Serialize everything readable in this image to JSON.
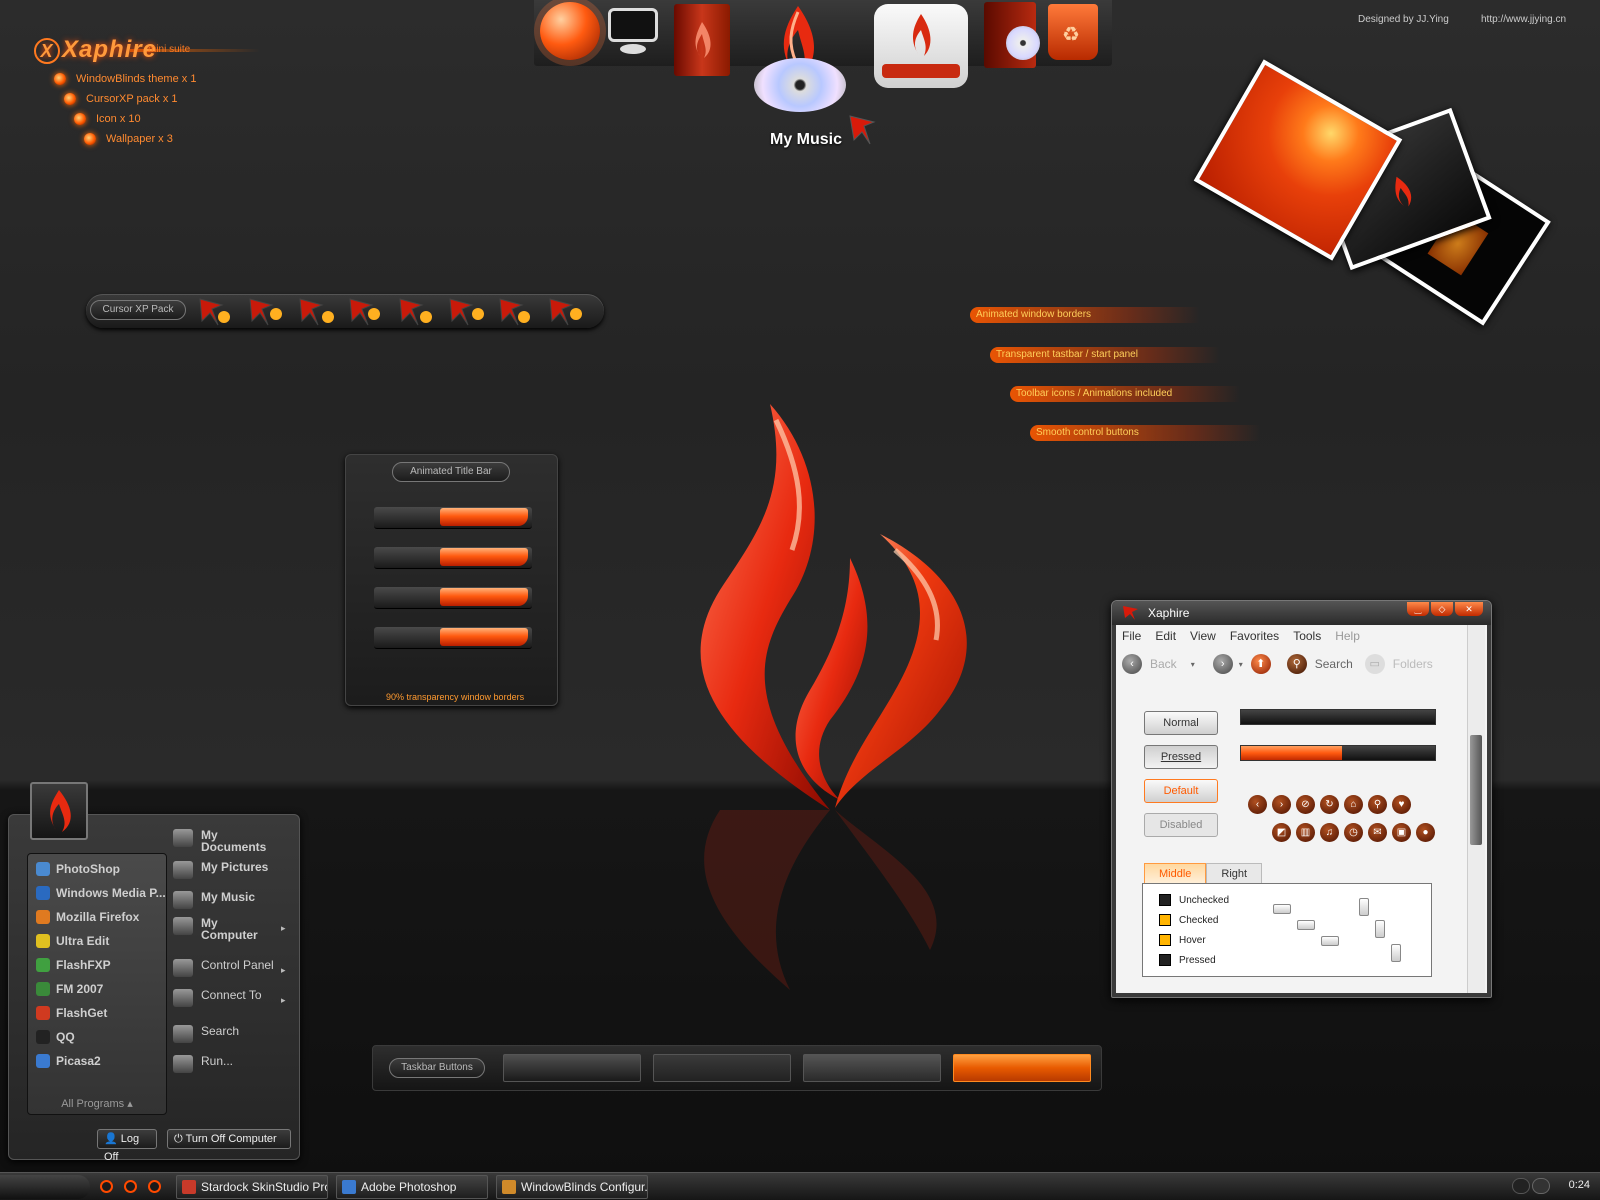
{
  "suite": {
    "logo": "Xaphire",
    "logo_mark": "X",
    "subtitle": "mini suite",
    "items": [
      "WindowBlinds theme x 1",
      "CursorXP pack x 1",
      "Icon x 10",
      "Wallpaper x 3"
    ]
  },
  "dock": {
    "hover_label": "My Music",
    "icons": [
      "planet-icon",
      "monitor-icon",
      "folder-icon",
      "music-cd-icon",
      "hard-drive-icon",
      "cd-case-icon",
      "recycle-bin-icon"
    ]
  },
  "credits": {
    "designer": "Designed by JJ.Ying",
    "url": "http://www.jjying.cn"
  },
  "cursor_pack": {
    "label": "Cursor XP Pack",
    "count": 8
  },
  "features": [
    "Animated window borders",
    "Transparent tastbar / start panel",
    "Toolbar icons / Animations included",
    "Smooth control buttons"
  ],
  "title_bar_panel": {
    "label": "Animated Title Bar",
    "footer": "90% transparency window borders"
  },
  "start_menu": {
    "programs": [
      {
        "name": "PhotoShop",
        "color": "#4a8ad0"
      },
      {
        "name": "Windows Media P...",
        "color": "#2a6ac0"
      },
      {
        "name": "Mozilla Firefox",
        "color": "#e07a20"
      },
      {
        "name": "Ultra Edit",
        "color": "#e0c020"
      },
      {
        "name": "FlashFXP",
        "color": "#40a040"
      },
      {
        "name": "FM 2007",
        "color": "#3a8a3a"
      },
      {
        "name": "FlashGet",
        "color": "#d03a20"
      },
      {
        "name": "QQ",
        "color": "#222222"
      },
      {
        "name": "Picasa2",
        "color": "#3a7ad0"
      }
    ],
    "all_programs": "All Programs",
    "places": [
      {
        "label": "My\nDocuments",
        "bold": true,
        "arrow": false
      },
      {
        "label": "My Pictures",
        "bold": true,
        "arrow": false
      },
      {
        "label": "My Music",
        "bold": true,
        "arrow": false
      },
      {
        "label": "My\nComputer",
        "bold": true,
        "arrow": true
      },
      {
        "label": "Control Panel",
        "bold": false,
        "arrow": true
      },
      {
        "label": "Connect To",
        "bold": false,
        "arrow": true
      },
      {
        "label": "Search",
        "bold": false,
        "arrow": false
      },
      {
        "label": "Run...",
        "bold": false,
        "arrow": false
      }
    ],
    "log_off": "Log Off",
    "turn_off": "Turn Off Computer"
  },
  "taskbar_buttons_panel": {
    "label": "Taskbar Buttons"
  },
  "window": {
    "title": "Xaphire",
    "menu": [
      "File",
      "Edit",
      "View",
      "Favorites",
      "Tools",
      "Help"
    ],
    "toolbar": {
      "back": "Back",
      "search": "Search",
      "folders": "Folders"
    },
    "buttons": [
      "Normal",
      "Pressed",
      "Default",
      "Disabled"
    ],
    "progress": [
      0,
      0.52
    ],
    "tabs": [
      "Middle",
      "Right"
    ],
    "checkboxes": [
      "Unchecked",
      "Checked",
      "Hover",
      "Pressed"
    ]
  },
  "taskbar": {
    "tasks": [
      "Stardock SkinStudio Pro...",
      "Adobe Photoshop",
      "WindowBlinds Configur..."
    ],
    "clock": "0:24"
  },
  "colors": {
    "accent": "#ff5a10",
    "accent_glow": "#ff9a3c",
    "background": "#242424"
  }
}
